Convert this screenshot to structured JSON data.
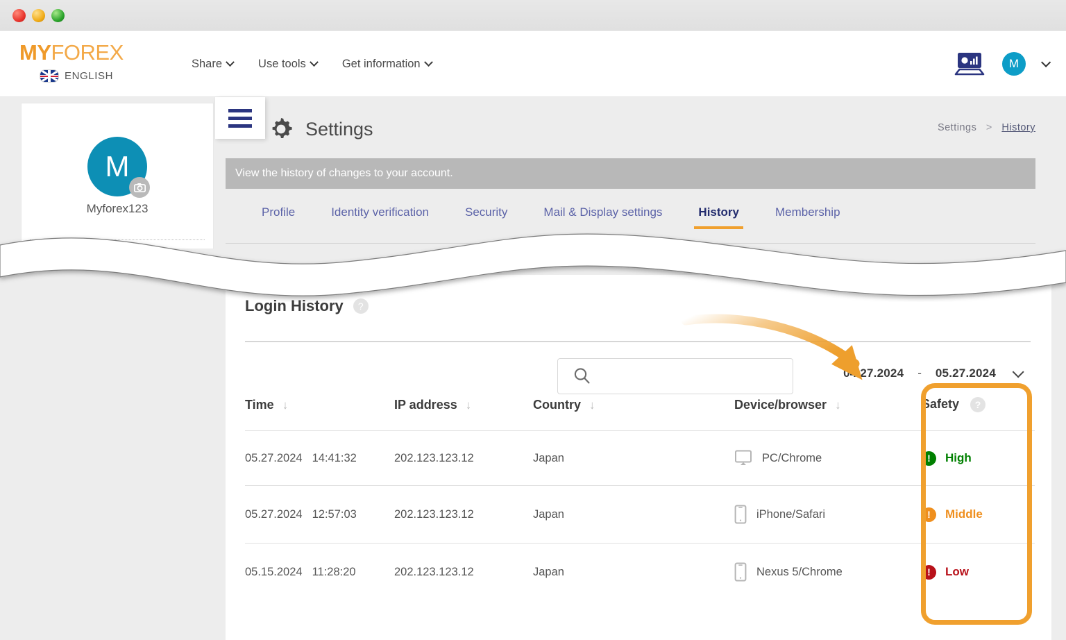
{
  "window": {
    "buttons": [
      "close",
      "minimize",
      "zoom"
    ]
  },
  "header": {
    "logo_my": "MY",
    "logo_forex": "FOREX",
    "language": "ENGLISH",
    "nav": [
      {
        "label": "Share"
      },
      {
        "label": "Use tools"
      },
      {
        "label": "Get information"
      }
    ],
    "avatar_initial": "M"
  },
  "profile": {
    "avatar_initial": "M",
    "username": "Myforex123"
  },
  "page": {
    "title": "Settings",
    "breadcrumb": {
      "root": "Settings",
      "separator": ">",
      "current": "History"
    },
    "notice": "View the history of changes to your account."
  },
  "tabs": [
    {
      "label": "Profile",
      "active": false
    },
    {
      "label": "Identity verification",
      "active": false
    },
    {
      "label": "Security",
      "active": false
    },
    {
      "label": "Mail & Display settings",
      "active": false
    },
    {
      "label": "History",
      "active": true
    },
    {
      "label": "Membership",
      "active": false
    }
  ],
  "login_history": {
    "title": "Login History",
    "help": "?",
    "search": {
      "value": "",
      "placeholder": ""
    },
    "date_from": "04.27.2024",
    "date_separator": "-",
    "date_to": "05.27.2024",
    "columns": [
      {
        "label": "Time",
        "sortable": true
      },
      {
        "label": "IP address",
        "sortable": true
      },
      {
        "label": "Country",
        "sortable": true
      },
      {
        "label": "Device/browser",
        "sortable": true
      },
      {
        "label": "Safety",
        "sortable": false,
        "help": "?"
      }
    ],
    "rows": [
      {
        "date": "05.27.2024",
        "time": "14:41:32",
        "ip": "202.123.123.12",
        "country": "Japan",
        "device_icon": "monitor-icon",
        "device": "PC/Chrome",
        "safety": "High",
        "safety_color": "#008000"
      },
      {
        "date": "05.27.2024",
        "time": "12:57:03",
        "ip": "202.123.123.12",
        "country": "Japan",
        "device_icon": "smartphone-icon",
        "device": "iPhone/Safari",
        "safety": "Middle",
        "safety_color": "#ef8f1e"
      },
      {
        "date": "05.15.2024",
        "time": "11:28:20",
        "ip": "202.123.123.12",
        "country": "Japan",
        "device_icon": "smartphone-icon",
        "device": "Nexus 5/Chrome",
        "safety": "Low",
        "safety_color": "#b8111a"
      }
    ]
  },
  "annotations": {
    "highlight_color": "#f0a02e",
    "arrow_color": "#ee9f2d",
    "target": "Safety"
  },
  "colors": {
    "brand_orange": "#ef9a2a",
    "accent_navy": "#2b3580",
    "avatar_teal": "#0d8fb5",
    "notice_gray": "#b8b8b8",
    "page_bg": "#ededed"
  }
}
